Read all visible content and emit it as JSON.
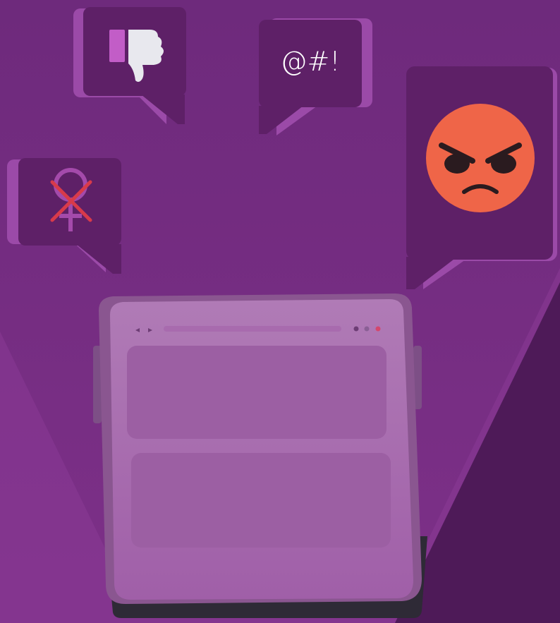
{
  "illustration": {
    "theme": "online harassment",
    "colors": {
      "background": "#7a2f86",
      "bubble": "#5e2067",
      "bubble_shadow": "#9b4aa8",
      "angry_face": "#ef6548",
      "cross": "#d83a4a",
      "phone_screen": "#a266a8",
      "phone_body": "#2e2a36"
    },
    "bubbles": [
      {
        "icon": "thumbs-down-icon"
      },
      {
        "icon": "censored-text",
        "text": "@#!"
      },
      {
        "icon": "crossed-female-symbol-icon"
      },
      {
        "icon": "angry-face-icon"
      }
    ]
  }
}
